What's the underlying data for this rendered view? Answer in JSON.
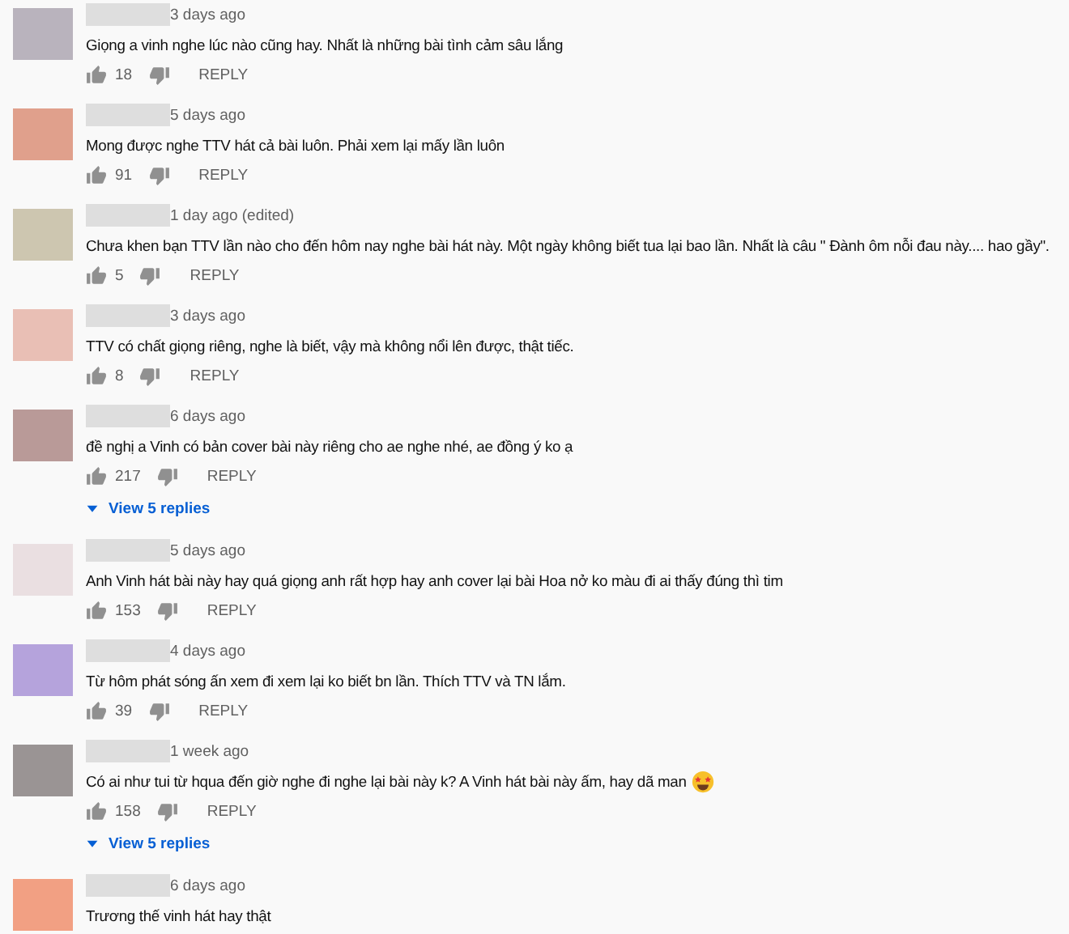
{
  "comments": [
    {
      "color": "#b9b3bd",
      "time": "3 days ago",
      "text": "Giọng a vinh nghe lúc nào cũng hay. Nhất là những bài tình cảm sâu lắng",
      "emoji": false,
      "likes": "18",
      "reply": "REPLY"
    },
    {
      "color": "#e0a08c",
      "time": "5 days ago",
      "text": "Mong được nghe TTV hát cả bài luôn. Phải xem lại mấy lần luôn",
      "emoji": false,
      "likes": "91",
      "reply": "REPLY"
    },
    {
      "color": "#cdc6b0",
      "time": "1 day ago (edited)",
      "text": "Chưa khen bạn TTV lần nào cho đến hôm nay nghe bài hát này. Một ngày không biết tua lại bao lần. Nhất là câu \" Đành ôm nỗi đau này.... hao gầy\".",
      "emoji": false,
      "likes": "5",
      "reply": "REPLY"
    },
    {
      "color": "#e9bfb5",
      "time": "3 days ago",
      "text": "TTV có chất giọng riêng, nghe là biết, vậy mà không nổi lên được, thật tiếc.",
      "emoji": false,
      "likes": "8",
      "reply": "REPLY"
    },
    {
      "color": "#b99a98",
      "time": "6 days ago",
      "text": "đề nghị a Vinh có bản cover bài này  riêng cho ae nghe nhé, ae đồng ý ko ạ",
      "emoji": false,
      "likes": "217",
      "reply": "REPLY",
      "replies": "View 5 replies"
    },
    {
      "color": "#eadfe1",
      "time": "5 days ago",
      "text": "Anh Vinh hát bài này hay quá giọng anh rất hợp hay anh cover lại bài Hoa nở ko màu đi ai thấy đúng thì tim",
      "emoji": false,
      "likes": "153",
      "reply": "REPLY"
    },
    {
      "color": "#b5a3dc",
      "time": "4 days ago",
      "text": "Từ hôm phát sóng ấn xem đi xem lại ko biết bn lần. Thích TTV và  TN lắm.",
      "emoji": false,
      "likes": "39",
      "reply": "REPLY"
    },
    {
      "color": "#9a9494",
      "time": "1 week ago",
      "text": "Có ai như tui từ hqua đến giờ nghe đi nghe lại bài này k? A Vinh hát bài này ấm, hay dã man",
      "emoji": true,
      "likes": "158",
      "reply": "REPLY",
      "replies": "View 5 replies"
    },
    {
      "color": "#f2a083",
      "time": "6 days ago",
      "text": "Trương thế vinh hát hay thật",
      "emoji": false
    }
  ]
}
